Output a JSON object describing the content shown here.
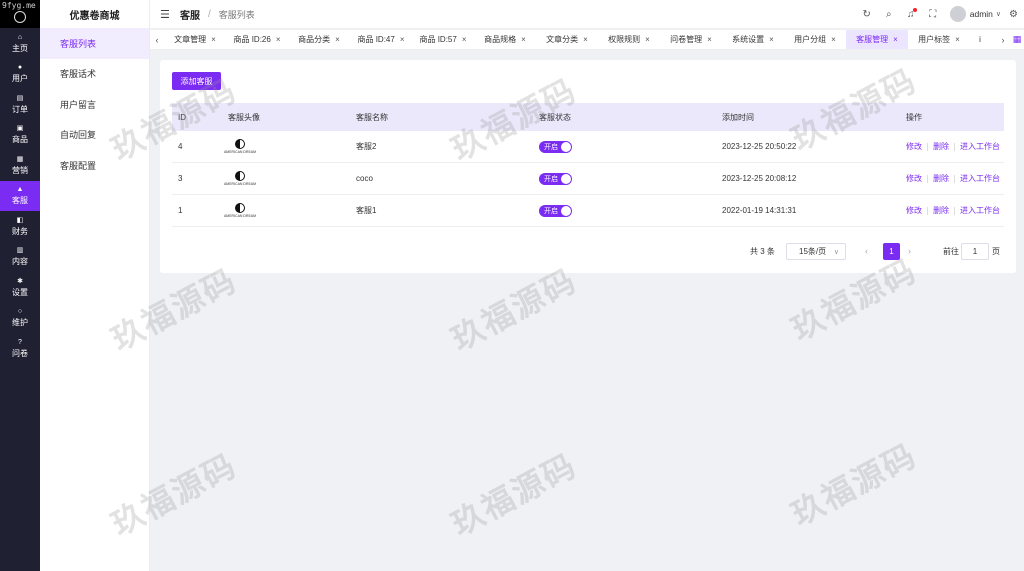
{
  "rail": {
    "watermark_text": "9fyg.me",
    "logo_text": "AMERICAN DREAM",
    "items": [
      {
        "label": "主页",
        "icon": "home-icon",
        "glyph": "⌂"
      },
      {
        "label": "用户",
        "icon": "user-icon",
        "glyph": "●"
      },
      {
        "label": "订单",
        "icon": "order-icon",
        "glyph": "▤"
      },
      {
        "label": "商品",
        "icon": "product-icon",
        "glyph": "▣"
      },
      {
        "label": "营销",
        "icon": "marketing-icon",
        "glyph": "▦"
      },
      {
        "label": "客服",
        "icon": "service-bell-icon",
        "glyph": "▲"
      },
      {
        "label": "财务",
        "icon": "finance-icon",
        "glyph": "◧"
      },
      {
        "label": "内容",
        "icon": "content-icon",
        "glyph": "▥"
      },
      {
        "label": "设置",
        "icon": "settings-icon",
        "glyph": "✱"
      },
      {
        "label": "维护",
        "icon": "maintenance-icon",
        "glyph": "○"
      },
      {
        "label": "问卷",
        "icon": "survey-icon",
        "glyph": "?"
      }
    ],
    "active_index": 5
  },
  "submenu": {
    "brand": "优惠卷商城",
    "items": [
      "客服列表",
      "客服话术",
      "用户留言",
      "自动回复",
      "客服配置"
    ],
    "active_index": 0
  },
  "header": {
    "crumb_section": "客服",
    "crumb_separator": "/",
    "crumb_page": "客服列表",
    "username": "admin"
  },
  "tabs": {
    "items": [
      "文章管理",
      "商品 ID:26",
      "商品分类",
      "商品 ID:47",
      "商品 ID:57",
      "商品规格",
      "文章分类",
      "权限规则",
      "问卷管理",
      "系统设置",
      "用户分组",
      "客服管理",
      "用户标签"
    ],
    "active_index": 11,
    "partial_label": "i"
  },
  "main": {
    "add_button": "添加客服",
    "columns": [
      "ID",
      "客服头像",
      "客服名称",
      "客服状态",
      "添加时间",
      "操作"
    ],
    "rows": [
      {
        "id": "4",
        "avatar_text": "AMERICAN DREAM",
        "name": "客服2",
        "status": "开启",
        "added": "2023-12-25 20:50:22"
      },
      {
        "id": "3",
        "avatar_text": "AMERICAN DREAM",
        "name": "coco",
        "status": "开启",
        "added": "2023-12-25 20:08:12"
      },
      {
        "id": "1",
        "avatar_text": "AMERICAN DREAM",
        "name": "客服1",
        "status": "开启",
        "added": "2022-01-19 14:31:31"
      }
    ],
    "actions": {
      "edit": "修改",
      "delete": "删除",
      "workbench": "进入工作台"
    }
  },
  "pagination": {
    "total_text": "共 3 条",
    "page_size": "15条/页",
    "current_page": "1",
    "goto_label": "前往",
    "goto_value": "1",
    "page_suffix": "页"
  },
  "watermark": "玖福源码",
  "colors": {
    "accent": "#7b2cf3",
    "rail_bg": "#1f2133",
    "table_header": "#ece8fb"
  }
}
